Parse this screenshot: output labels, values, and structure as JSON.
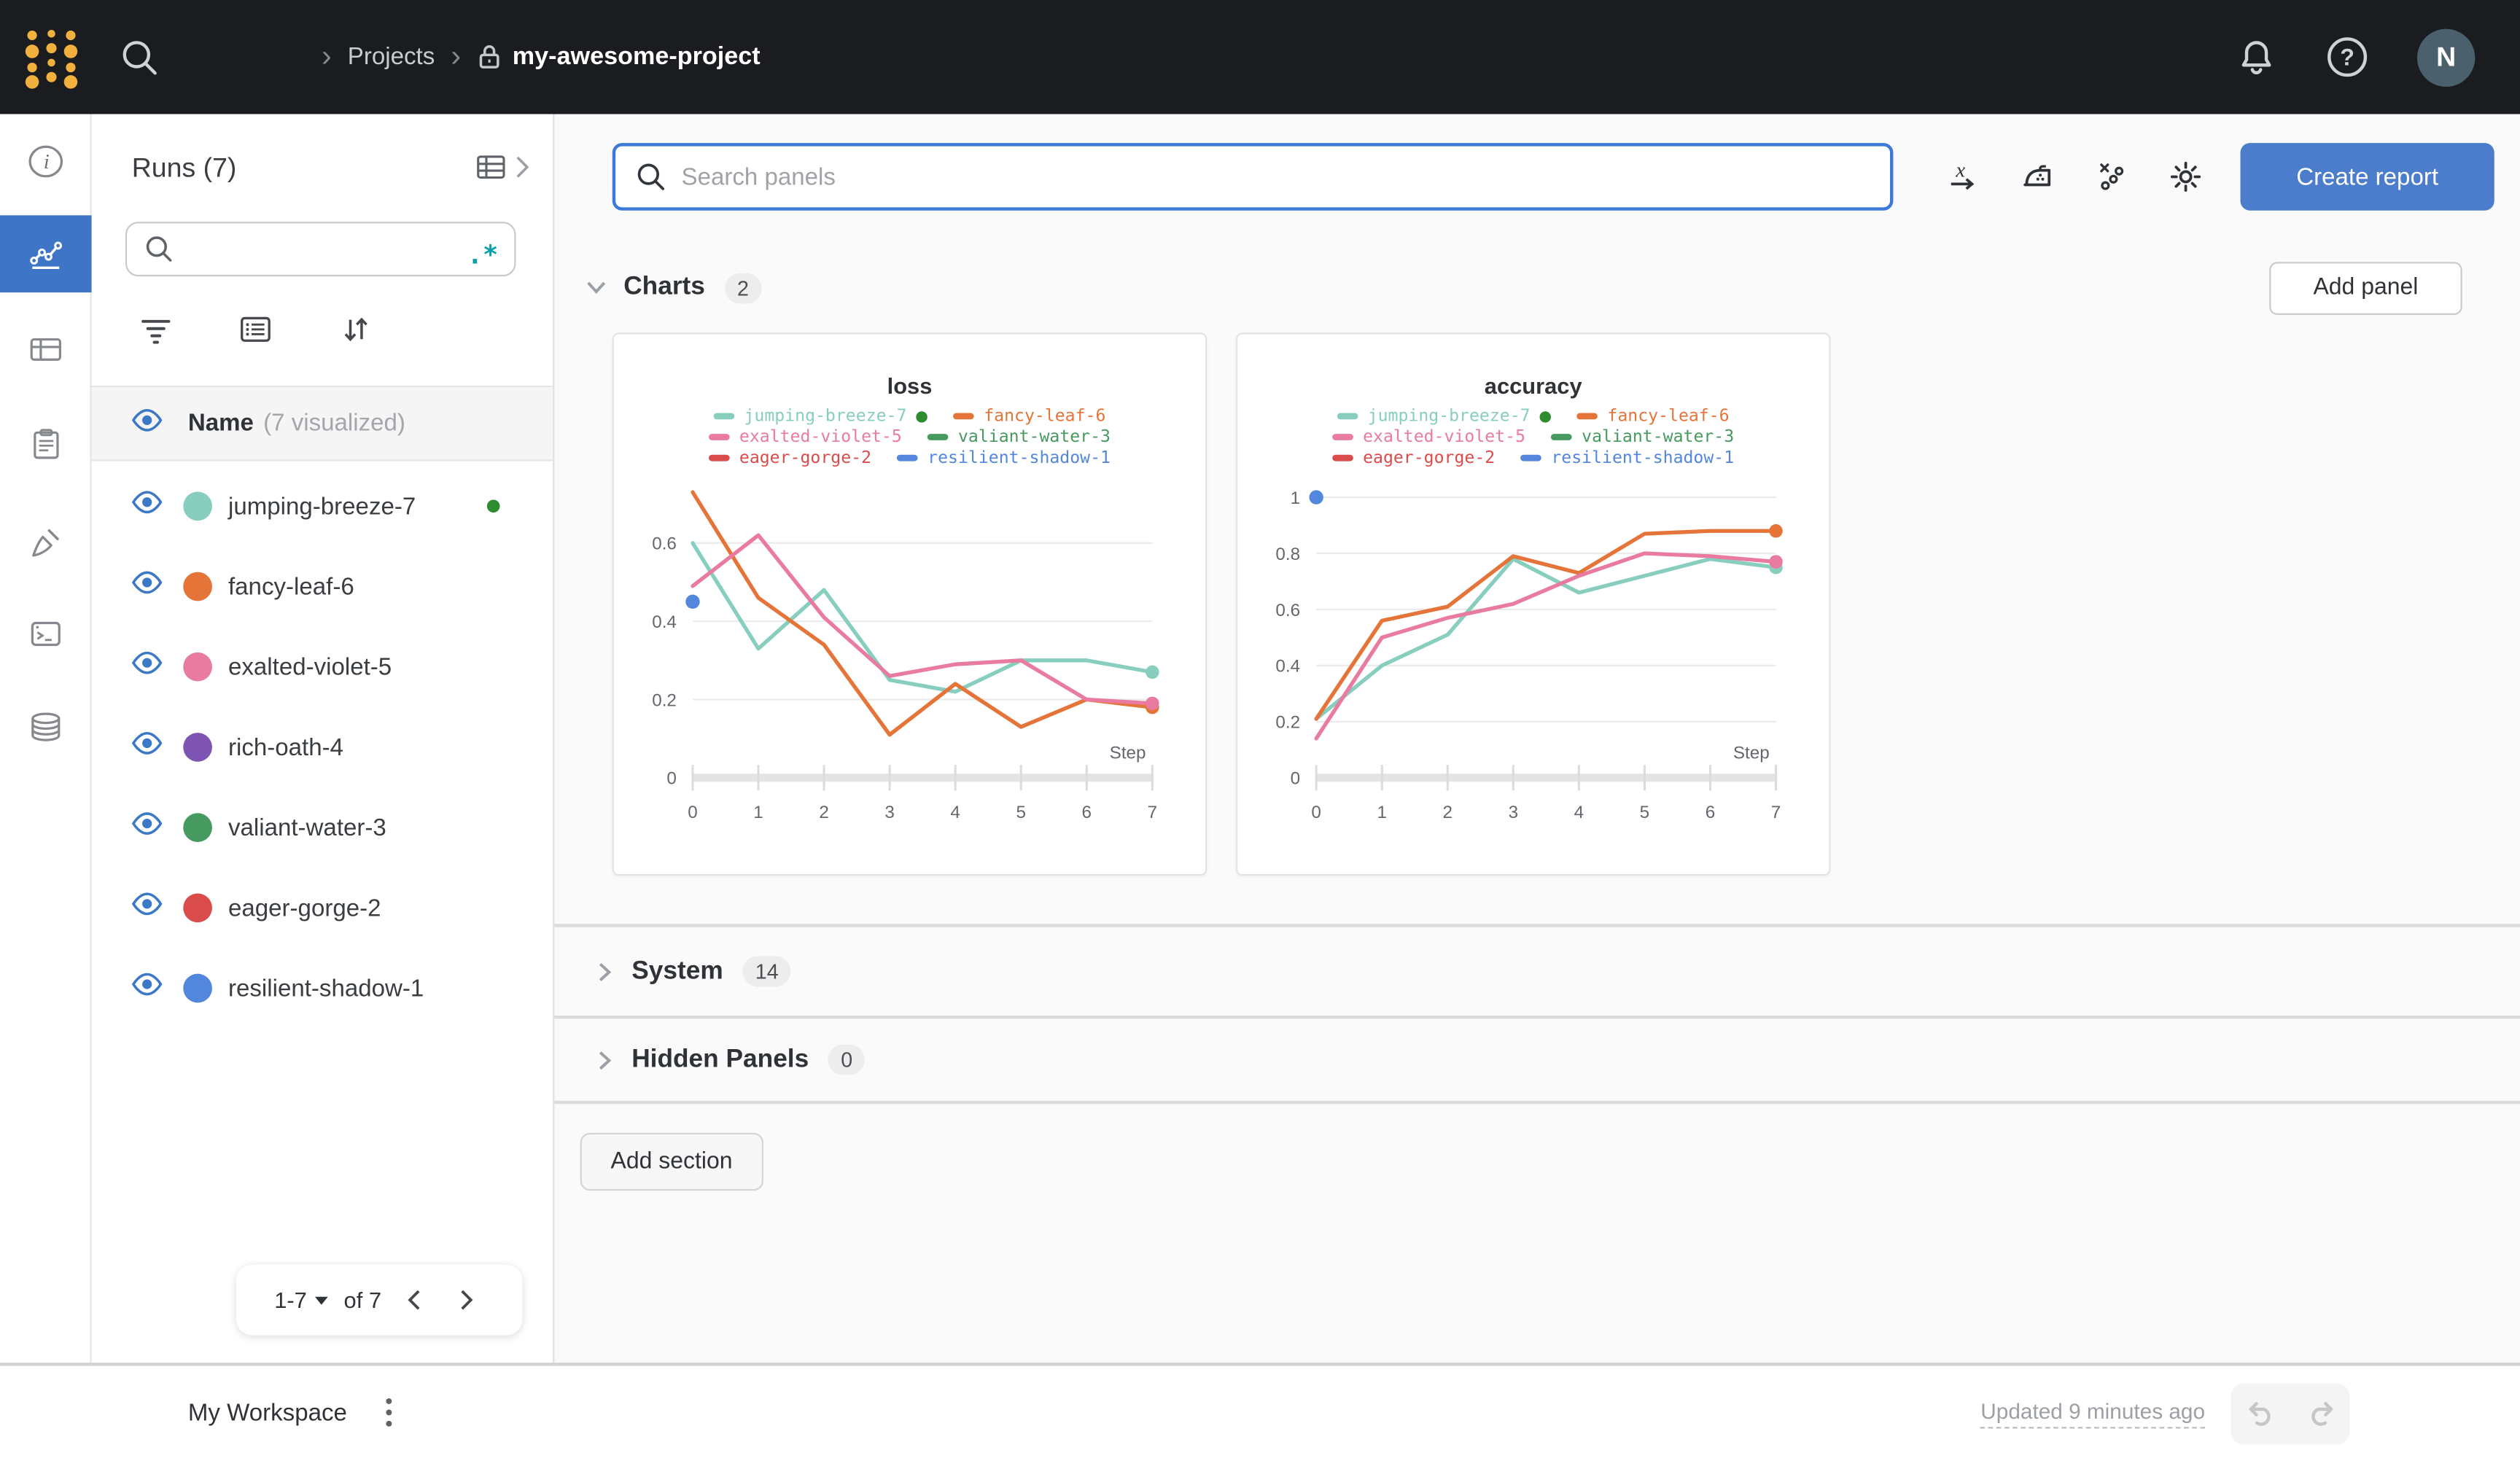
{
  "colors": {
    "topbar_bg": "#1a1c20",
    "accent_blue": "#3e75c6",
    "create_report_bg": "#4b7dcc",
    "logo_gold": "#f2b13e",
    "running_green": "#2e8b2e",
    "eye_blue": "#3b79c6",
    "regex_teal": "#0e9fad"
  },
  "topbar": {
    "breadcrumb": {
      "projects": "Projects",
      "project": "my-awesome-project"
    },
    "avatar_initial": "N"
  },
  "sidebar": {
    "title": "Runs (7)",
    "search_placeholder": "",
    "regex": ".*",
    "name_header": "Name",
    "visualized": "(7 visualized)",
    "runs": [
      {
        "name": "jumping-breeze-7",
        "color": "#87CEBF",
        "running": true
      },
      {
        "name": "fancy-leaf-6",
        "color": "#E57439",
        "running": false
      },
      {
        "name": "exalted-violet-5",
        "color": "#E87B9F",
        "running": false
      },
      {
        "name": "rich-oath-4",
        "color": "#7D54B2",
        "running": false
      },
      {
        "name": "valiant-water-3",
        "color": "#479A5F",
        "running": false
      },
      {
        "name": "eager-gorge-2",
        "color": "#DA4C4C",
        "running": false
      },
      {
        "name": "resilient-shadow-1",
        "color": "#5387DD",
        "running": false
      }
    ],
    "pagination": {
      "range": "1-7",
      "of": "of 7"
    }
  },
  "main": {
    "toolbar": {
      "search_placeholder": "Search panels",
      "create_report": "Create report"
    },
    "sections": {
      "charts": {
        "label": "Charts",
        "count": "2"
      },
      "system": {
        "label": "System",
        "count": "14"
      },
      "hidden": {
        "label": "Hidden Panels",
        "count": "0"
      }
    },
    "add_panel": "Add panel",
    "add_section": "Add section"
  },
  "footer": {
    "workspace": "My Workspace",
    "updated": "Updated 9 minutes ago"
  },
  "chart_data": [
    {
      "type": "line",
      "title": "loss",
      "xlabel": "Step",
      "x": [
        0,
        1,
        2,
        3,
        4,
        5,
        6,
        7
      ],
      "yticks": [
        0,
        0.2,
        0.4,
        0.6
      ],
      "ylim": [
        0,
        0.76
      ],
      "grid": true,
      "legend_position": "top",
      "series": [
        {
          "name": "jumping-breeze-7",
          "color": "#87CEBF",
          "running": true,
          "end_dot": true,
          "values": [
            0.6,
            0.33,
            0.48,
            0.25,
            0.22,
            0.3,
            0.3,
            0.27
          ]
        },
        {
          "name": "fancy-leaf-6",
          "color": "#E57439",
          "running": false,
          "end_dot": true,
          "values": [
            0.73,
            0.46,
            0.34,
            0.11,
            0.24,
            0.13,
            0.2,
            0.18
          ]
        },
        {
          "name": "exalted-violet-5",
          "color": "#E87B9F",
          "running": false,
          "end_dot": true,
          "values": [
            0.49,
            0.62,
            0.41,
            0.26,
            0.29,
            0.3,
            0.2,
            0.19
          ]
        },
        {
          "name": "valiant-water-3",
          "color": "#479A5F",
          "running": false,
          "end_dot": false,
          "values": []
        },
        {
          "name": "eager-gorge-2",
          "color": "#DA4C4C",
          "running": false,
          "end_dot": false,
          "values": []
        },
        {
          "name": "resilient-shadow-1",
          "color": "#5387DD",
          "running": false,
          "end_dot": false,
          "values": [
            0.45
          ]
        }
      ]
    },
    {
      "type": "line",
      "title": "accuracy",
      "xlabel": "Step",
      "x": [
        0,
        1,
        2,
        3,
        4,
        5,
        6,
        7
      ],
      "yticks": [
        0,
        0.2,
        0.4,
        0.6,
        0.8,
        1
      ],
      "ylim": [
        0,
        1.06
      ],
      "grid": true,
      "legend_position": "top",
      "series": [
        {
          "name": "jumping-breeze-7",
          "color": "#87CEBF",
          "running": true,
          "end_dot": true,
          "values": [
            0.21,
            0.4,
            0.51,
            0.78,
            0.66,
            0.72,
            0.78,
            0.75
          ]
        },
        {
          "name": "fancy-leaf-6",
          "color": "#E57439",
          "running": false,
          "end_dot": true,
          "values": [
            0.21,
            0.56,
            0.61,
            0.79,
            0.73,
            0.87,
            0.88,
            0.88
          ]
        },
        {
          "name": "exalted-violet-5",
          "color": "#E87B9F",
          "running": false,
          "end_dot": true,
          "values": [
            0.14,
            0.5,
            0.57,
            0.62,
            0.72,
            0.8,
            0.79,
            0.77
          ]
        },
        {
          "name": "valiant-water-3",
          "color": "#479A5F",
          "running": false,
          "end_dot": false,
          "values": []
        },
        {
          "name": "eager-gorge-2",
          "color": "#DA4C4C",
          "running": false,
          "end_dot": false,
          "values": []
        },
        {
          "name": "resilient-shadow-1",
          "color": "#5387DD",
          "running": false,
          "end_dot": false,
          "values": [
            1.0
          ]
        }
      ]
    }
  ]
}
